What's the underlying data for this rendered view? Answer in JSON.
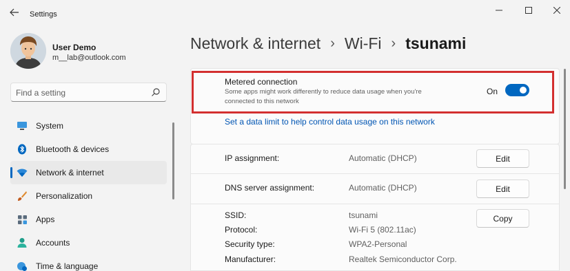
{
  "window": {
    "title": "Settings"
  },
  "profile": {
    "name": "User Demo",
    "email": "m__lab@outlook.com"
  },
  "search": {
    "placeholder": "Find a setting"
  },
  "nav": {
    "items": [
      {
        "label": "System",
        "icon": "monitor-icon"
      },
      {
        "label": "Bluetooth & devices",
        "icon": "bluetooth-icon"
      },
      {
        "label": "Network & internet",
        "icon": "wifi-icon",
        "active": true
      },
      {
        "label": "Personalization",
        "icon": "brush-icon"
      },
      {
        "label": "Apps",
        "icon": "apps-icon"
      },
      {
        "label": "Accounts",
        "icon": "person-icon"
      },
      {
        "label": "Time & language",
        "icon": "globe-clock-icon"
      }
    ]
  },
  "breadcrumb": {
    "items": [
      "Network & internet",
      "Wi-Fi"
    ],
    "current": "tsunami"
  },
  "metered": {
    "title": "Metered connection",
    "description": "Some apps might work differently to reduce data usage when you're connected to this network",
    "toggle_label": "On",
    "enabled": true
  },
  "data_limit_link": "Set a data limit to help control data usage on this network",
  "properties": {
    "ip_assignment": {
      "label": "IP assignment:",
      "value": "Automatic (DHCP)",
      "button": "Edit"
    },
    "dns_assignment": {
      "label": "DNS server assignment:",
      "value": "Automatic (DHCP)",
      "button": "Edit"
    },
    "copy_button": "Copy",
    "details": [
      {
        "label": "SSID:",
        "value": "tsunami"
      },
      {
        "label": "Protocol:",
        "value": "Wi-Fi 5 (802.11ac)"
      },
      {
        "label": "Security type:",
        "value": "WPA2-Personal"
      },
      {
        "label": "Manufacturer:",
        "value": "Realtek Semiconductor Corp."
      }
    ]
  },
  "colors": {
    "accent": "#0067c0",
    "highlight": "#d32f2f",
    "link": "#0055b3"
  }
}
